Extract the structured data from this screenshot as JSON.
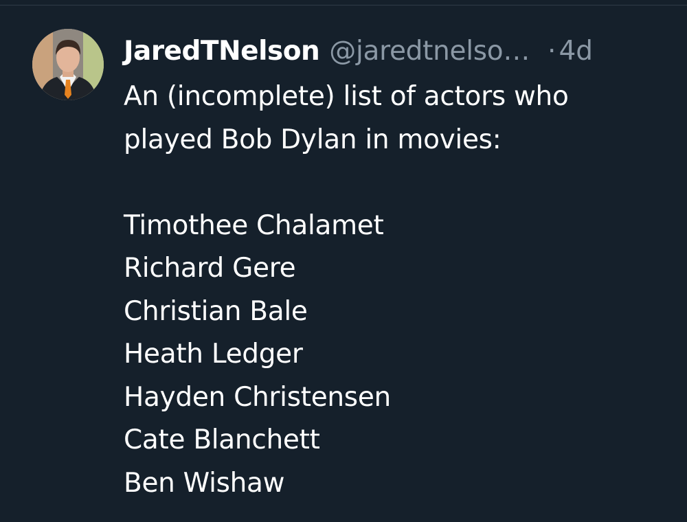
{
  "tweet": {
    "author": {
      "display_name": "JaredTNelson",
      "handle": "@jaredtnelso…",
      "avatar_icon": "profile-photo"
    },
    "separator": "·",
    "timestamp": "4d",
    "text_lines": [
      "An (incomplete) list of actors who",
      "played Bob Dylan in movies:"
    ],
    "actors": [
      "Timothee Chalamet",
      "Richard Gere",
      "Christian Bale",
      "Heath Ledger",
      "Hayden Christensen",
      "Cate Blanchett",
      "Ben Wishaw"
    ]
  },
  "colors": {
    "background": "#15202b",
    "primary_text": "#ffffff",
    "secondary_text": "#8b98a5",
    "tie_accent": "#e8831f"
  }
}
